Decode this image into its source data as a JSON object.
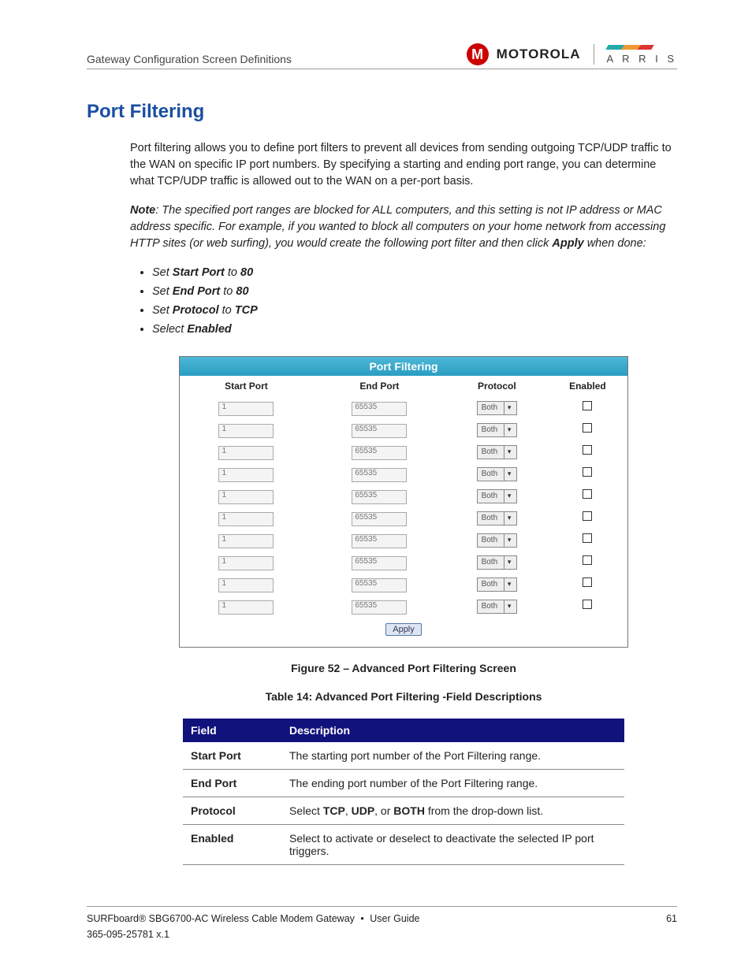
{
  "header": {
    "breadcrumb": "Gateway Configuration Screen Definitions",
    "brand1": "MOTOROLA",
    "brand2": "A R R I S"
  },
  "title": "Port Filtering",
  "intro": "Port filtering allows you to define port filters to prevent all devices from sending outgoing TCP/UDP traffic to the WAN on specific IP port numbers. By specifying a starting and ending port range, you can determine what TCP/UDP traffic is allowed out to the WAN on a per-port basis.",
  "note_lead": "Note",
  "note_body": ": The specified port ranges are blocked for ALL computers, and this setting is not IP address or MAC address specific. For example, if you wanted to block all computers on your home network from accessing HTTP sites (or web surfing), you would create the following port filter and then click ",
  "note_apply": "Apply",
  "note_tail": " when done:",
  "bullets": [
    {
      "pre": "Set ",
      "b": "Start Port",
      "mid": " to ",
      "b2": "80"
    },
    {
      "pre": "Set ",
      "b": "End Port",
      "mid": " to ",
      "b2": "80"
    },
    {
      "pre": "Set ",
      "b": "Protocol",
      "mid": " to ",
      "b2": "TCP"
    },
    {
      "pre": "Select ",
      "b": "Enabled",
      "mid": "",
      "b2": ""
    }
  ],
  "screenshot": {
    "panel_title": "Port Filtering",
    "cols": {
      "c1": "Start Port",
      "c2": "End Port",
      "c3": "Protocol",
      "c4": "Enabled"
    },
    "rows": [
      {
        "start": "1",
        "end": "65535",
        "proto": "Both",
        "enabled": false
      },
      {
        "start": "1",
        "end": "65535",
        "proto": "Both",
        "enabled": false
      },
      {
        "start": "1",
        "end": "65535",
        "proto": "Both",
        "enabled": false
      },
      {
        "start": "1",
        "end": "65535",
        "proto": "Both",
        "enabled": false
      },
      {
        "start": "1",
        "end": "65535",
        "proto": "Both",
        "enabled": false
      },
      {
        "start": "1",
        "end": "65535",
        "proto": "Both",
        "enabled": false
      },
      {
        "start": "1",
        "end": "65535",
        "proto": "Both",
        "enabled": false
      },
      {
        "start": "1",
        "end": "65535",
        "proto": "Both",
        "enabled": false
      },
      {
        "start": "1",
        "end": "65535",
        "proto": "Both",
        "enabled": false
      },
      {
        "start": "1",
        "end": "65535",
        "proto": "Both",
        "enabled": false
      }
    ],
    "apply_label": "Apply"
  },
  "figure_caption": "Figure 52 – Advanced Port Filtering Screen",
  "table_caption": "Table 14: Advanced Port Filtering -Field Descriptions",
  "desc_table": {
    "head_field": "Field",
    "head_desc": "Description",
    "rows": [
      {
        "field": "Start Port",
        "pre": "The starting port number of the Port Filtering range."
      },
      {
        "field": "End Port",
        "pre": "The ending port number of the Port Filtering range."
      },
      {
        "field": "Protocol",
        "pre": "Select ",
        "b1": "TCP",
        "m1": ", ",
        "b2": "UDP",
        "m2": ", or ",
        "b3": "BOTH",
        "post": " from the drop-down list."
      },
      {
        "field": "Enabled",
        "pre": "Select to activate or deselect to deactivate the selected IP port triggers."
      }
    ]
  },
  "footer": {
    "product": "SURFboard® SBG6700-AC Wireless Cable Modem Gateway",
    "guide": "User Guide",
    "page": "61",
    "docnum": "365-095-25781 x.1"
  }
}
